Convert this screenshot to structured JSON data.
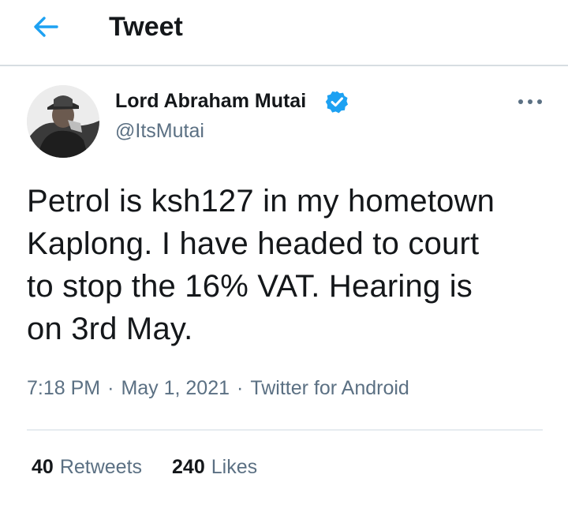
{
  "header": {
    "title": "Tweet",
    "back_icon": "arrow-left-icon",
    "accent_color": "#1da1f2"
  },
  "tweet": {
    "author": {
      "name": "Lord Abraham Mutai",
      "handle": "@ItsMutai",
      "verified": true
    },
    "text": "Petrol is ksh127 in my hometown\nKaplong. I have headed to court\nto stop the 16% VAT. Hearing is\non 3rd May.",
    "meta": {
      "time": "7:18 PM",
      "date": "May 1, 2021",
      "source": "Twitter for Android",
      "separator": "·"
    },
    "stats": {
      "retweets": "40",
      "retweets_label": "Retweets",
      "likes": "240",
      "likes_label": "Likes"
    }
  }
}
